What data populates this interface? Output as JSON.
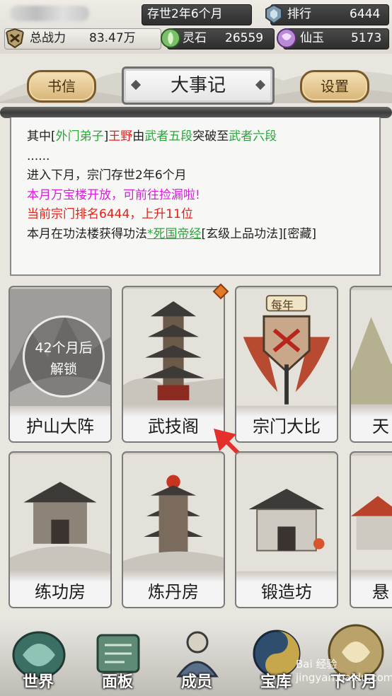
{
  "status": {
    "sect_time": "存世2年6个月",
    "rank_label": "排行",
    "rank_value": "6444",
    "power_label": "总战力",
    "power_value": "83.47万",
    "spirit_stone_label": "灵石",
    "spirit_stone_value": "26559",
    "jade_label": "仙玉",
    "jade_value": "5173"
  },
  "header": {
    "left_button": "书信",
    "title": "大事记",
    "right_button": "设置"
  },
  "log": {
    "line1": {
      "a": "其中[",
      "b": "外门弟子",
      "c": "]",
      "d": "王野",
      "e": "由",
      "f": "武者五段",
      "g": "突破至",
      "h": "武者六段"
    },
    "line2": "......",
    "line3": "进入下月，宗门存世2年6个月",
    "line4": "本月万宝楼开放，可前往捡漏啦!",
    "line5": "当前宗门排名6444，上升11位",
    "line6": {
      "a": "本月在功法楼获得功法",
      "b": "*死国帝经",
      "c": "[玄级上品功法][密藏]"
    }
  },
  "cards_row1": [
    {
      "label": "护山大阵",
      "lock_line1": "42个月后",
      "lock_line2": "解锁"
    },
    {
      "label": "武技阁"
    },
    {
      "label": "宗门大比",
      "badge": "每年"
    },
    {
      "label": "天"
    }
  ],
  "cards_row2": [
    {
      "label": "练功房"
    },
    {
      "label": "炼丹房"
    },
    {
      "label": "锻造坊"
    },
    {
      "label": "悬"
    }
  ],
  "nav": {
    "world": "世界",
    "panel": "面板",
    "members": "成员",
    "treasury": "宝库",
    "next_month": "下个月"
  },
  "watermark": "Bai 经验 jingyan.baidu.com",
  "colors": {
    "green": "#2aa53a",
    "red": "#e0221c",
    "magenta": "#d91edc"
  }
}
